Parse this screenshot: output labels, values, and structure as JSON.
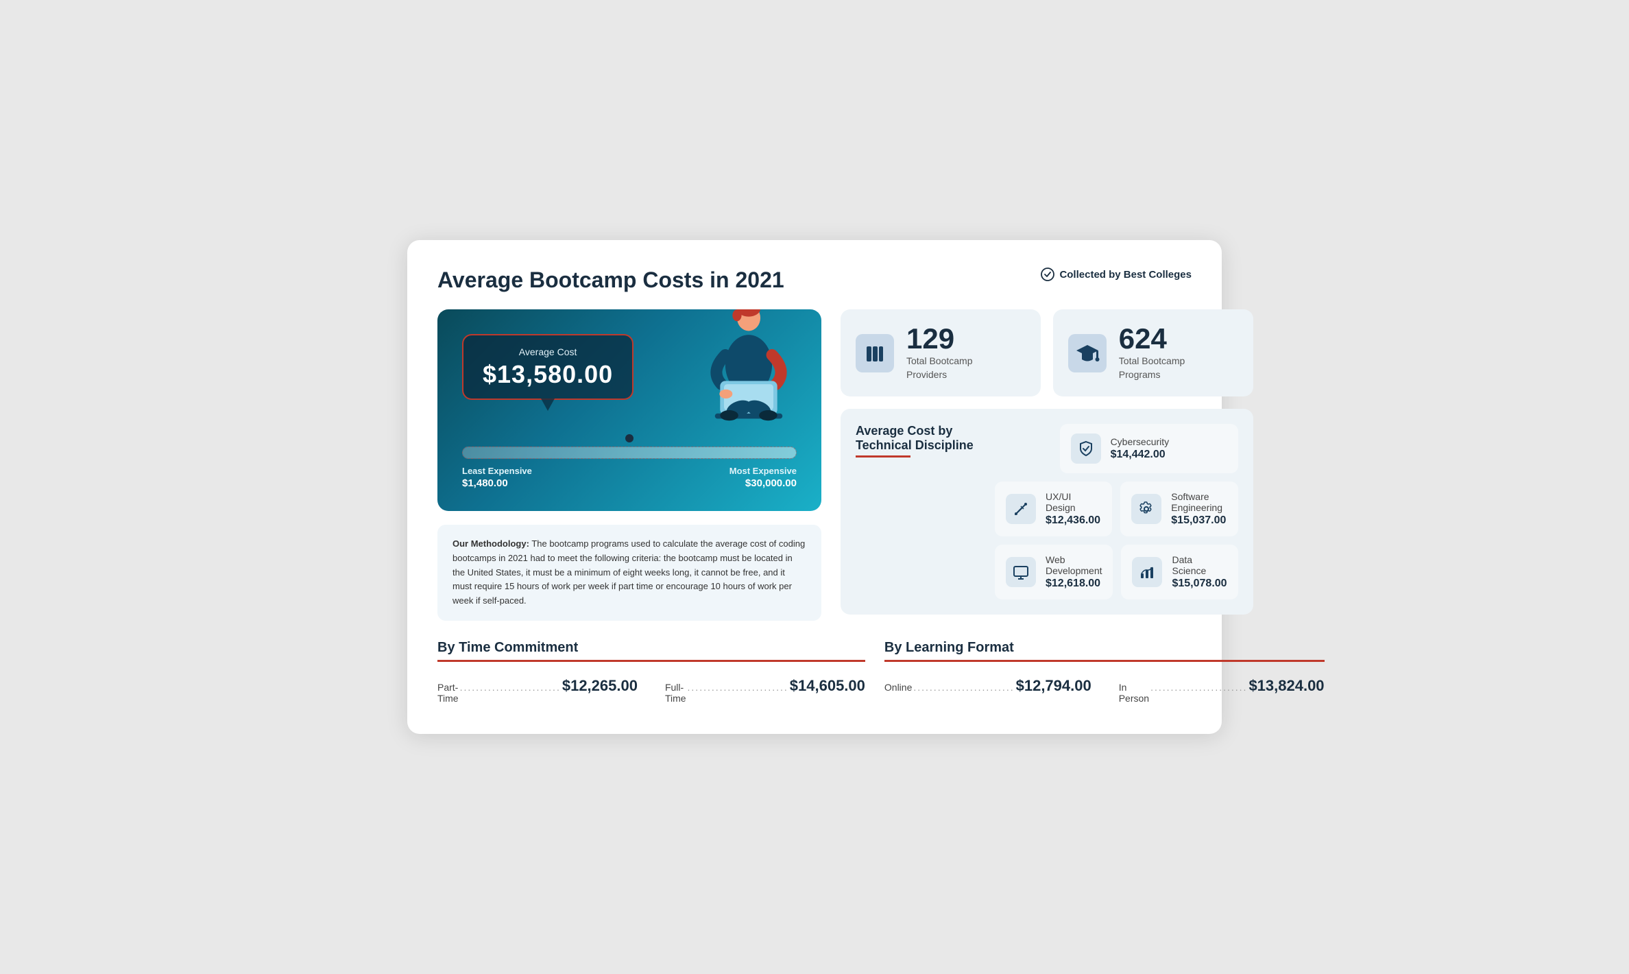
{
  "header": {
    "title": "Average Bootcamp Costs in 2021",
    "collected_by": "Collected by Best Colleges"
  },
  "gauge": {
    "label": "Average Cost",
    "amount": "$13,580.00",
    "least_expensive_label": "Least Expensive",
    "least_expensive_value": "$1,480.00",
    "most_expensive_label": "Most Expensive",
    "most_expensive_value": "$30,000.00"
  },
  "methodology": {
    "bold": "Our Methodology:",
    "text": " The bootcamp programs used to calculate the average cost of coding bootcamps in 2021 had to meet the following criteria: the bootcamp must be located in the United States, it must be a minimum of eight weeks long, it cannot be free, and it must require 15 hours of work per week if part time or encourage 10 hours of work per week if self-paced."
  },
  "stats": [
    {
      "icon": "books",
      "number": "129",
      "label": "Total Bootcamp\nProviders"
    },
    {
      "icon": "graduation",
      "number": "624",
      "label": "Total Bootcamp\nPrograms"
    }
  ],
  "discipline": {
    "title": "Average Cost by\nTechnical Discipline",
    "items": [
      {
        "icon": "shield",
        "name": "Cybersecurity",
        "cost": "$14,442.00"
      },
      {
        "icon": "palette",
        "name": "UX/UI Design",
        "cost": "$12,436.00"
      },
      {
        "icon": "gear",
        "name": "Software Engineering",
        "cost": "$15,037.00"
      },
      {
        "icon": "monitor",
        "name": "Web Development",
        "cost": "$12,618.00"
      },
      {
        "icon": "chart",
        "name": "Data Science",
        "cost": "$15,078.00"
      }
    ]
  },
  "time_commitment": {
    "title": "By Time Commitment",
    "items": [
      {
        "label": "Part-Time",
        "dots": ".........................",
        "value": "$12,265.00"
      },
      {
        "label": "Full-Time",
        "dots": ".........................",
        "value": "$14,605.00"
      }
    ]
  },
  "learning_format": {
    "title": "By Learning Format",
    "items": [
      {
        "label": "Online",
        "dots": ".........................",
        "value": "$12,794.00"
      },
      {
        "label": "In Person",
        "dots": "........................",
        "value": "$13,824.00"
      }
    ]
  }
}
